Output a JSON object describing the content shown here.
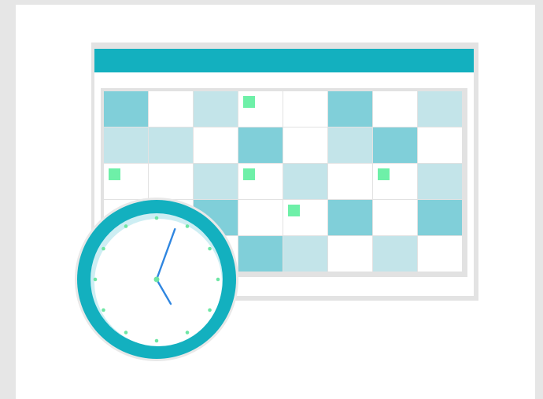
{
  "colors": {
    "page_bg": "#e6e6e6",
    "card_bg": "#ffffff",
    "accent": "#13b0bf",
    "cell_dark": "#80cfd9",
    "cell_light": "#c3e4e9",
    "cell_white": "#ffffff",
    "event_marker": "#6ef0a8",
    "clock_hands": "#2f86e0",
    "clock_ticks": "#6ee6a4",
    "calendar_frame": "#e3e3e3"
  },
  "calendar": {
    "columns": 8,
    "rows": 5,
    "cells": [
      [
        "dark",
        "white",
        "light",
        "white",
        "white",
        "dark",
        "white",
        "light"
      ],
      [
        "light",
        "light",
        "white",
        "dark",
        "white",
        "light",
        "dark",
        "white"
      ],
      [
        "white",
        "white",
        "light",
        "white",
        "light",
        "white",
        "white",
        "light"
      ],
      [
        "white",
        "white",
        "dark",
        "white",
        "white",
        "dark",
        "white",
        "dark"
      ],
      [
        "white",
        "white",
        "white",
        "dark",
        "light",
        "white",
        "light",
        "white"
      ]
    ],
    "event_markers": [
      {
        "row": 0,
        "col": 3
      },
      {
        "row": 2,
        "col": 0
      },
      {
        "row": 2,
        "col": 3
      },
      {
        "row": 2,
        "col": 6
      },
      {
        "row": 3,
        "col": 4
      }
    ]
  },
  "clock": {
    "hour_hand_angle_deg": 150,
    "minute_hand_angle_deg": 20,
    "tick_count": 12
  }
}
